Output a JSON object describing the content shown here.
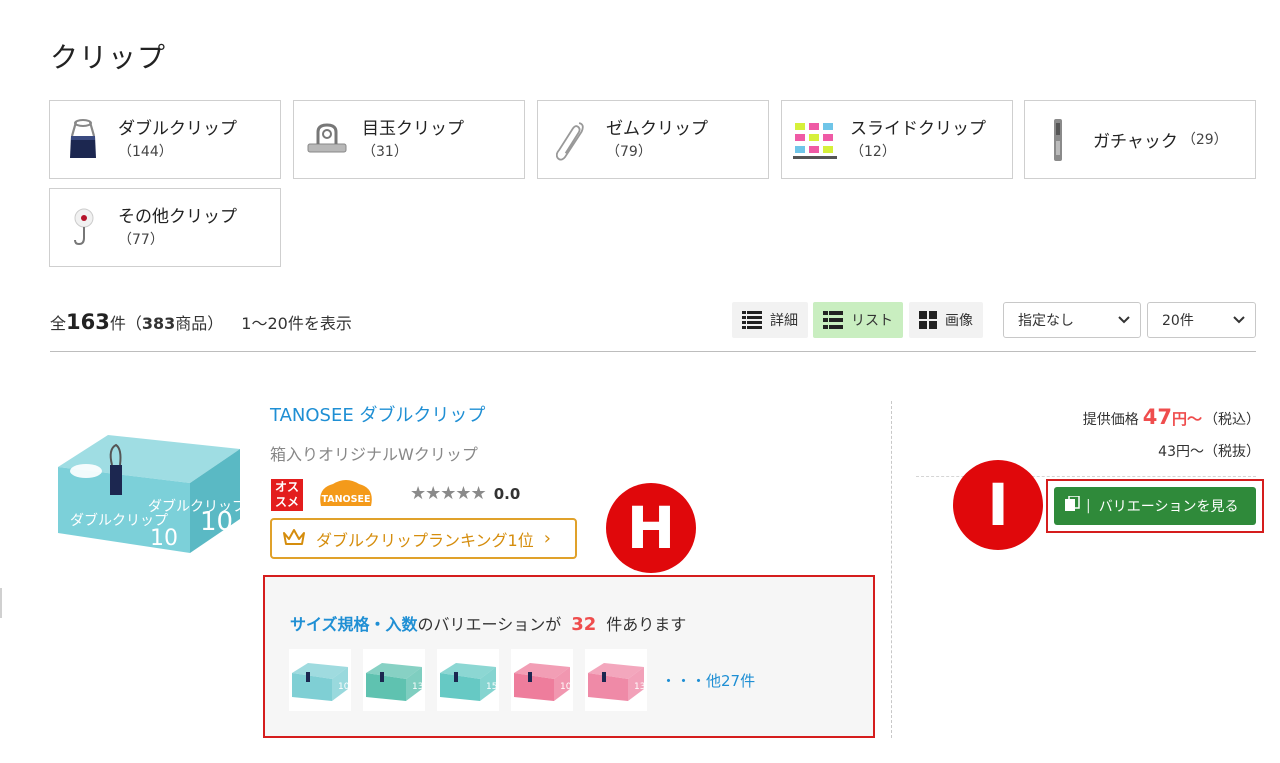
{
  "page_title": "クリップ",
  "categories": [
    {
      "name": "ダブルクリップ",
      "count": "（144）",
      "icon": "double-clip-icon"
    },
    {
      "name": "目玉クリップ",
      "count": "（31）",
      "icon": "binder-clip-icon"
    },
    {
      "name": "ゼムクリップ",
      "count": "（79）",
      "icon": "paper-clip-icon"
    },
    {
      "name": "スライドクリップ",
      "count": "（12）",
      "icon": "slide-clip-icon"
    },
    {
      "name": "ガチャック",
      "count": "（29）",
      "icon": "gachakku-icon"
    },
    {
      "name": "その他クリップ",
      "count": "（77）",
      "icon": "other-clip-icon"
    }
  ],
  "result": {
    "prefix": "全",
    "total": "163",
    "unit": "件（",
    "products": "383",
    "products_suffix": "商品）",
    "range": "1〜20件を表示"
  },
  "view_modes": [
    {
      "label": "詳細",
      "active": false
    },
    {
      "label": "リスト",
      "active": true
    },
    {
      "label": "画像",
      "active": false
    }
  ],
  "sort_select": {
    "value": "指定なし"
  },
  "per_page_select": {
    "value": "20件"
  },
  "product": {
    "name": "TANOSEE ダブルクリップ",
    "subtitle": "箱入りオリジナルWクリップ",
    "badge": "オス\nスメ",
    "badge_line1": "オス",
    "badge_line2": "スメ",
    "brand_logo": "TANOSEE",
    "rating": "0.0",
    "stars": "★★★★★",
    "ranking": "ダブルクリップランキング1位",
    "ranking_chevron": "›",
    "variation": {
      "spec_label": "サイズ規格・入数",
      "text_mid": "のバリエーションが",
      "count": "32",
      "text_end": "件あります",
      "more": "・・・他27件",
      "thumbs": [
        {
          "label": "10",
          "color": "#7fcfd4"
        },
        {
          "label": "13",
          "color": "#5fc2b0"
        },
        {
          "label": "15",
          "color": "#66c9c4"
        },
        {
          "label": "10",
          "color": "#ee7d9c"
        },
        {
          "label": "13",
          "color": "#ef8aa7"
        }
      ]
    },
    "price": {
      "label": "提供価格",
      "value": "47",
      "unit": "円〜",
      "tax_in": "（税込）",
      "tax_ex_line": "43円〜（税抜）"
    },
    "variation_button": "バリエーションを見る"
  },
  "markers": {
    "h": "H",
    "i": "I"
  },
  "colors": {
    "link_blue": "#1f8fd4",
    "price_red": "#ef4d4d",
    "button_green": "#2f8a3a",
    "highlight_red": "#d51d1d"
  }
}
